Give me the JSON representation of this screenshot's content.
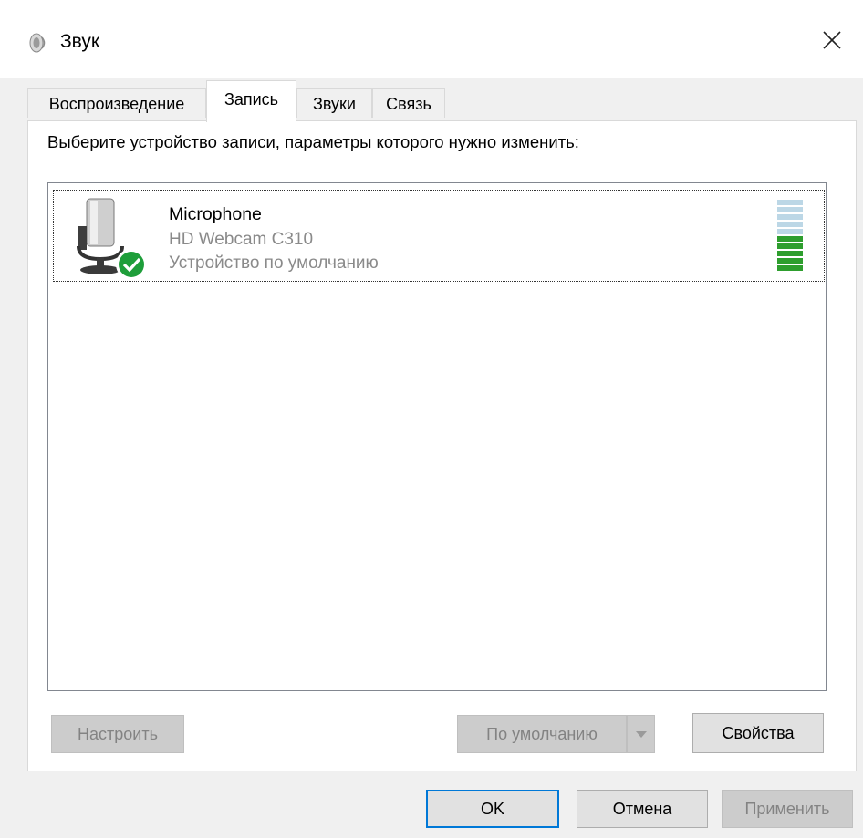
{
  "window": {
    "title": "Звук",
    "title_icon": "speaker-icon",
    "close_icon": "close-icon"
  },
  "tabs": [
    {
      "label": "Воспроизведение",
      "active": false
    },
    {
      "label": "Запись",
      "active": true
    },
    {
      "label": "Звуки",
      "active": false
    },
    {
      "label": "Связь",
      "active": false
    }
  ],
  "recording": {
    "instruction": "Выберите устройство записи, параметры которого нужно изменить:",
    "devices": [
      {
        "name": "Microphone",
        "description": "HD Webcam C310",
        "status": "Устройство по умолчанию",
        "icon": "microphone-icon",
        "badge_icon": "default-check-icon",
        "level_meter": {
          "segments_total": 10,
          "segments_active": 5
        }
      }
    ]
  },
  "buttons": {
    "configure": "Настроить",
    "set_default": "По умолчанию",
    "properties": "Свойства",
    "ok": "OK",
    "cancel": "Отмена",
    "apply": "Применить"
  },
  "colors": {
    "accent": "#0078d7",
    "check_badge": "#1e9e3a",
    "meter_active": "#2e9e2e",
    "meter_inactive": "#bcd7e6"
  }
}
